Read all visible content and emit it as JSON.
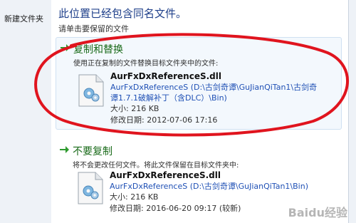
{
  "explorer": {
    "new_folder_label": "新建文件夹"
  },
  "dialog": {
    "heading": "此位置已经包含同名文件。",
    "subheading": "请单击要保留的文件"
  },
  "options": [
    {
      "title": "复制和替换",
      "description": "使用正在复制的文件替换目标文件夹中的文件:",
      "file_name": "AurFxDxReferenceS.dll",
      "path_line1": "AurFxDxReferenceS (D:\\古剑奇谭\\GuJianQiTan1\\古剑奇",
      "path_line2": "谭1.7.1破解补丁（含DLC）\\Bin)",
      "size": "大小: 216 KB",
      "modified": "修改日期: 2012-07-06 17:16",
      "icon": "arrow-right-icon"
    },
    {
      "title": "不要复制",
      "description": "将不会更改任何文件。将此文件保留在目标文件夹中:",
      "file_name": "AurFxDxReferenceS.dll",
      "path_line1": "AurFxDxReferenceS (D:\\古剑奇谭\\GuJianQiTan1\\Bin)",
      "size": "大小: 216 KB",
      "modified": "修改日期: 2016-06-20 09:17 (较新)",
      "icon": "arrow-right-icon"
    }
  ],
  "watermark": "Baidu经验",
  "colors": {
    "heading": "#1e3f8a",
    "option_title": "#1a6b1a",
    "path_link": "#1f50b5",
    "annotation": "#e0141e"
  }
}
